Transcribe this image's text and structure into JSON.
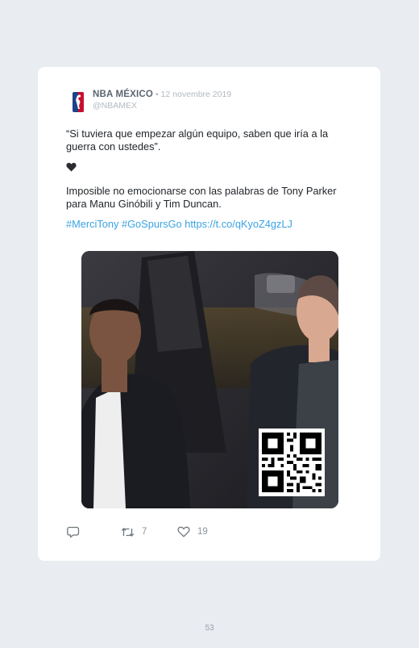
{
  "tweet": {
    "author_name": "NBA MÉXICO",
    "date_separator": " • ",
    "date": "12 novembre 2019",
    "handle": "@NBAMEX",
    "paragraph_1": "“Si tuviera que empezar algún equipo, saben que iría a la guerra con ustedes”.",
    "paragraph_3": "Imposible no emocionarse con las palabras de Tony Parker para Manu Ginóbili y Tim Duncan.",
    "links": "#MerciTony #GoSpursGo https://t.co/qKyoZ4gzLJ",
    "heart_emoji_icon": "black-heart-icon",
    "media_description_icon": "video-still-with-qr-code"
  },
  "actions": {
    "reply_count": "",
    "retweet_count": "7",
    "like_count": "19"
  },
  "page": {
    "number": "53"
  },
  "colors": {
    "link": "#3aa3e3",
    "author": "#5b6570",
    "muted": "#b3b9c0",
    "background": "#e9ecf0"
  }
}
